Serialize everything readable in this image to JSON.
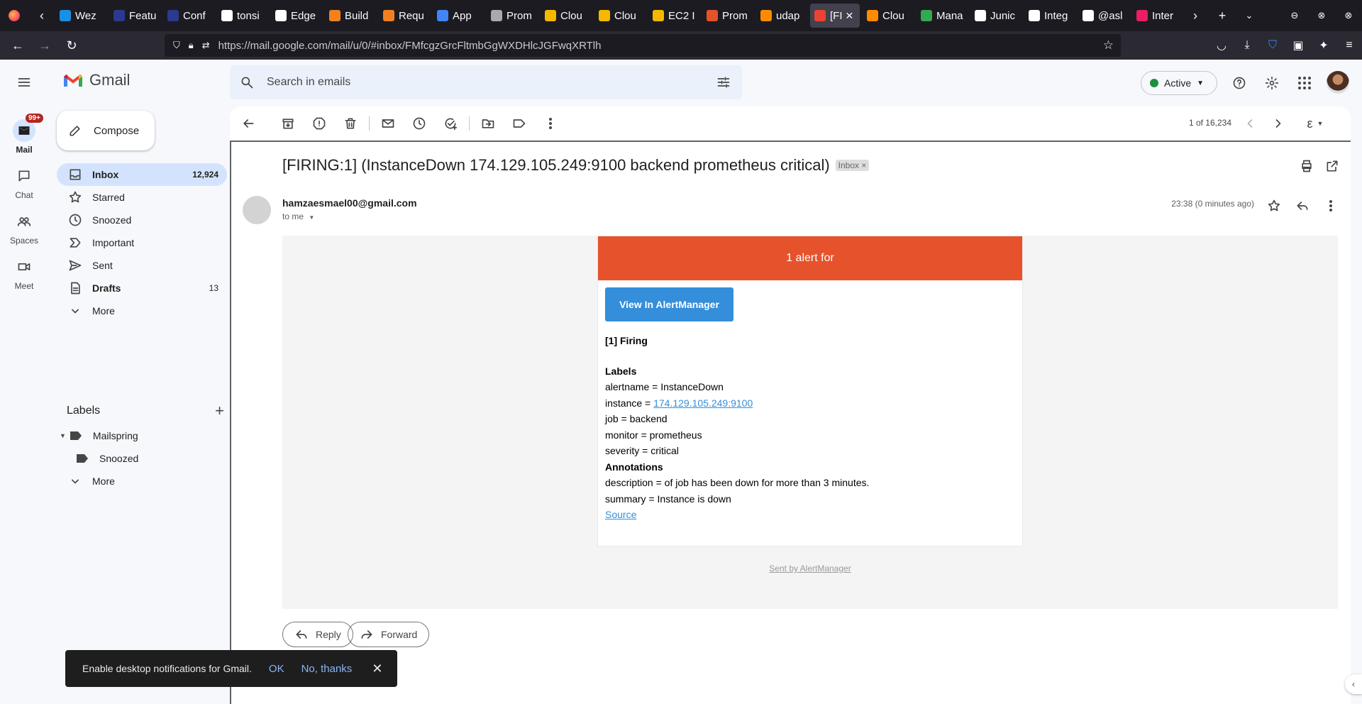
{
  "browser": {
    "tabs": [
      {
        "title": "Wez",
        "color": "#1a8fe3"
      },
      {
        "title": "Featu",
        "color": "#2b3a8f"
      },
      {
        "title": "Conf",
        "color": "#2b3a8f"
      },
      {
        "title": "tonsi",
        "color": "#ffffff"
      },
      {
        "title": "Edge",
        "color": "#ffffff"
      },
      {
        "title": "Build",
        "color": "#f38020"
      },
      {
        "title": "Requ",
        "color": "#f38020"
      },
      {
        "title": "App",
        "color": "#4285f4"
      },
      {
        "title": "Prom",
        "color": "#aaaaaa"
      },
      {
        "title": "Clou",
        "color": "#f5b800"
      },
      {
        "title": "Clou",
        "color": "#f5b800"
      },
      {
        "title": "EC2 I",
        "color": "#f5b800"
      },
      {
        "title": "Prom",
        "color": "#e6522c"
      },
      {
        "title": "udap",
        "color": "#ff8c00"
      },
      {
        "title": "[FI",
        "color": "#ea4335",
        "active": true
      },
      {
        "title": "Clou",
        "color": "#ff8c00"
      },
      {
        "title": "Mana",
        "color": "#34a853"
      },
      {
        "title": "Junic",
        "color": "#ffffff"
      },
      {
        "title": "Integ",
        "color": "#ffffff"
      },
      {
        "title": "@asl",
        "color": "#ffffff"
      },
      {
        "title": "Inter",
        "color": "#e91e63"
      }
    ],
    "url": "https://mail.google.com/mail/u/0/#inbox/FMfcgzGrcFltmbGgWXDHlcJGFwqXRTlh"
  },
  "gmail": {
    "logo_text": "Gmail",
    "search_placeholder": "Search in emails",
    "status": "Active",
    "rail": [
      {
        "label": "Mail",
        "badge": "99+"
      },
      {
        "label": "Chat"
      },
      {
        "label": "Spaces"
      },
      {
        "label": "Meet"
      }
    ],
    "compose_label": "Compose",
    "nav": [
      {
        "label": "Inbox",
        "count": "12,924"
      },
      {
        "label": "Starred"
      },
      {
        "label": "Snoozed"
      },
      {
        "label": "Important"
      },
      {
        "label": "Sent"
      },
      {
        "label": "Drafts",
        "count": "13"
      },
      {
        "label": "More"
      }
    ],
    "labels_title": "Labels",
    "labels": [
      {
        "label": "Mailspring"
      },
      {
        "label": "Snoozed"
      },
      {
        "label": "More"
      }
    ],
    "pager": "1 of 16,234",
    "lang_glyph": "ε"
  },
  "message": {
    "subject": "[FIRING:1] (InstanceDown 174.129.105.249:9100 backend prometheus critical)",
    "inbox_chip": "Inbox",
    "sender": "hamzaesmael00@gmail.com",
    "to": "to me",
    "time": "23:38 (0 minutes ago)",
    "alert_header": "1 alert for",
    "view_button": "View In AlertManager",
    "firing": "[1] Firing",
    "labels_heading": "Labels",
    "alertname": "alertname = InstanceDown",
    "instance_prefix": "instance = ",
    "instance_link": "174.129.105.249:9100",
    "job": "job = backend",
    "monitor": "monitor = prometheus",
    "severity": "severity = critical",
    "annotations_heading": "Annotations",
    "description": "description = of job has been down for more than 3 minutes.",
    "summary": "summary = Instance is down",
    "source": "Source",
    "sent_by": "Sent by AlertManager",
    "reply": "Reply",
    "forward": "Forward"
  },
  "snackbar": {
    "text": "Enable desktop notifications for Gmail.",
    "ok": "OK",
    "no": "No, thanks"
  }
}
